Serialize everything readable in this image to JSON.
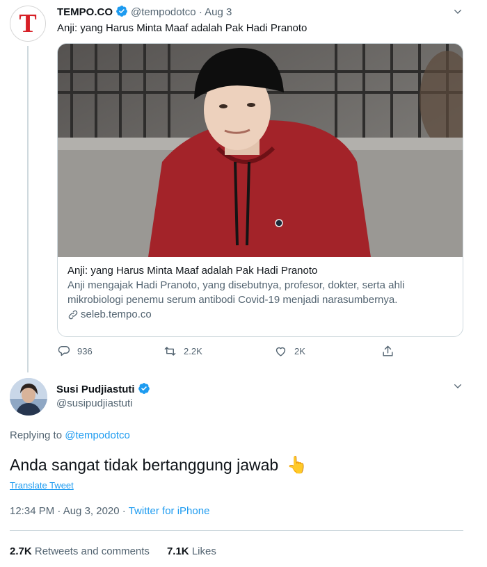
{
  "tweet1": {
    "display_name": "TEMPO.CO",
    "handle": "@tempodotco",
    "sep": "·",
    "date": "Aug 3",
    "text": "Anji: yang Harus Minta Maaf adalah Pak Hadi Pranoto",
    "avatar_letter": "T",
    "card": {
      "title": "Anji: yang Harus Minta Maaf adalah Pak Hadi Pranoto",
      "description": "Anji mengajak Hadi Pranoto, yang disebutnya, profesor, dokter, serta ahli mikrobiologi penemu serum antibodi Covid-19 menjadi narasumbernya.",
      "domain": "seleb.tempo.co"
    },
    "actions": {
      "replies": "936",
      "retweets": "2.2K",
      "likes": "2K"
    }
  },
  "tweet2": {
    "display_name": "Susi Pudjiastuti",
    "handle": "@susipudjiastuti",
    "replying_prefix": "Replying to",
    "replying_to": "@tempodotco",
    "text": "Anda sangat tidak bertanggung jawab",
    "emoji": "👆",
    "translate": "Translate Tweet",
    "time": "12:34 PM · Aug 3, 2020 ·",
    "source": "Twitter for iPhone",
    "retweets_count": "2.7K",
    "retweets_label": "Retweets and comments",
    "likes_count": "7.1K",
    "likes_label": "Likes"
  },
  "colors": {
    "accent": "#1d9bf0",
    "muted": "#536471",
    "border": "#cfd9de",
    "tempo_red": "#d71f26"
  }
}
